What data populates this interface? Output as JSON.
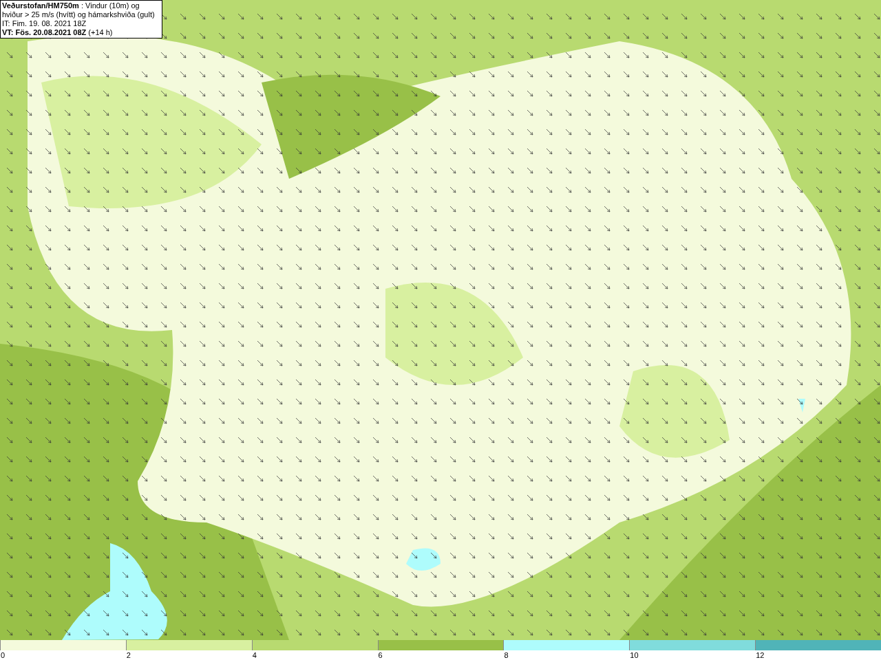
{
  "title_box": {
    "lines": [
      "**Veðurstofan/HM750m** : Vindur (10m) og hviður > 25 m/s (hvítt) og hámarkshviða (gult)",
      "IT: Fim. 19. 08. 2021 18Z",
      "**VT: Fös. 20.08.2021 08Z** (+14 h)"
    ]
  },
  "legend": [
    {
      "label": "0",
      "color": "#f4fadc"
    },
    {
      "label": "2",
      "color": "#d8f0a0"
    },
    {
      "label": "4",
      "color": "#b8da70"
    },
    {
      "label": "6",
      "color": "#98c048"
    },
    {
      "label": "8",
      "color": "#aefcfc"
    },
    {
      "label": "10",
      "color": "#80dcdc"
    },
    {
      "label": "12",
      "color": "#50b4b8"
    }
  ]
}
